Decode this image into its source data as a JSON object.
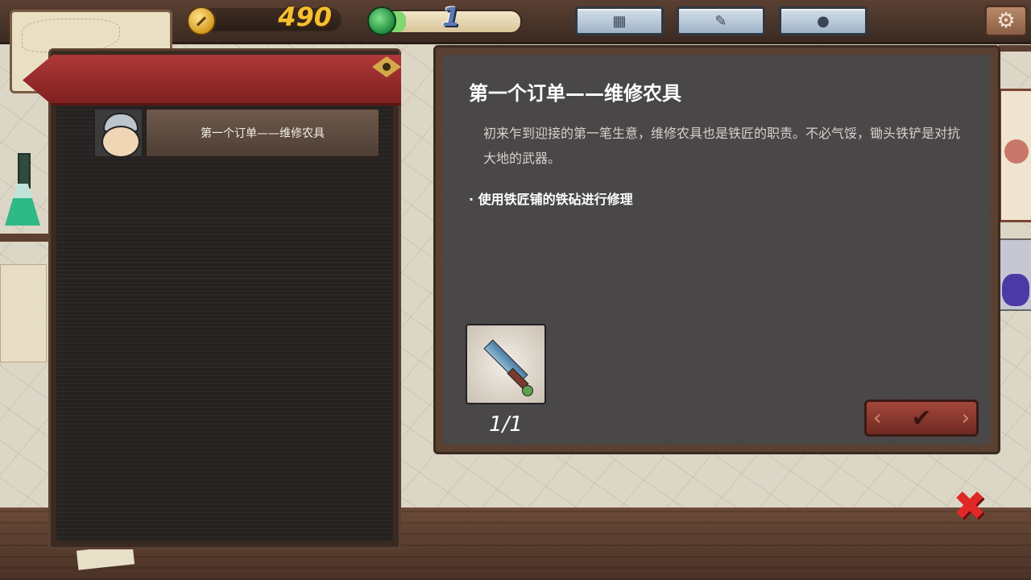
{
  "hud": {
    "coins": "490",
    "gems": "1"
  },
  "menu": {
    "grid_icon": "grid-icon",
    "scroll_icon": "scroll-icon",
    "person_icon": "person-icon",
    "settings_icon": "gear-icon"
  },
  "quest_list": {
    "items": [
      {
        "label": "第一个订单——维修农具",
        "avatar": "helmet-merchant-avatar"
      }
    ]
  },
  "detail": {
    "title": "第一个订单——维修农具",
    "description": "初来乍到迎接的第一笔生意，维修农具也是铁匠的职责。不必气馁，锄头铁铲是对抗大地的武器。",
    "objective": "· 使用铁匠铺的铁砧进行修理",
    "reward": {
      "icon": "sword-icon",
      "count": "1/1"
    },
    "confirm_icon": "check-icon"
  },
  "close_icon": "close-icon",
  "colors": {
    "banner": "#9a2a2a",
    "coin_text": "#f5c030",
    "gem_text": "#5f78b0",
    "close": "#e02828"
  }
}
